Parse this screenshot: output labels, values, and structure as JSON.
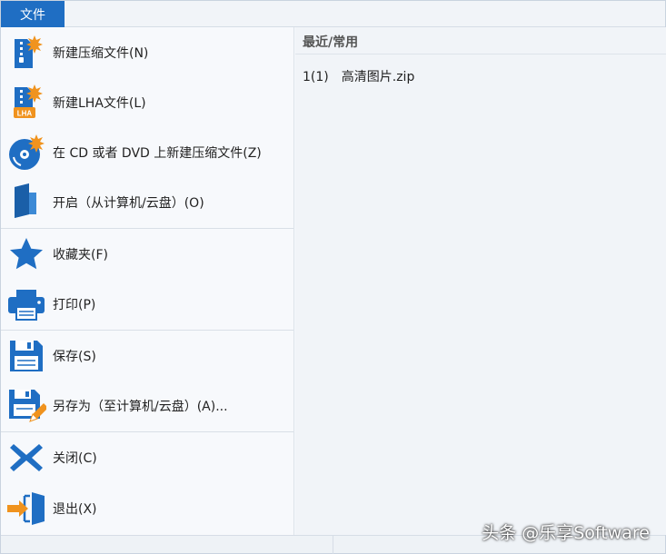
{
  "menubar": {
    "file_tab": "文件"
  },
  "menu_items": [
    {
      "label": "新建压缩文件(N)",
      "icon": "new-zip-icon"
    },
    {
      "label": "新建LHA文件(L)",
      "icon": "new-lha-icon"
    },
    {
      "label": "在 CD 或者 DVD 上新建压缩文件(Z)",
      "icon": "new-disc-archive-icon"
    },
    {
      "label": "开启（从计算机/云盘）(O)",
      "icon": "open-icon"
    },
    {
      "label": "收藏夹(F)",
      "icon": "star-icon"
    },
    {
      "label": "打印(P)",
      "icon": "printer-icon"
    },
    {
      "label": "保存(S)",
      "icon": "save-icon"
    },
    {
      "label": "另存为（至计算机/云盘）(A)...",
      "icon": "save-as-icon"
    },
    {
      "label": "关闭(C)",
      "icon": "close-icon"
    },
    {
      "label": "退出(X)",
      "icon": "exit-icon"
    }
  ],
  "lha_badge": "LHA",
  "recent": {
    "header": "最近/常用",
    "items": [
      {
        "num": "1(1)",
        "name": "高清图片.zip"
      }
    ]
  },
  "watermark": "头条 @乐享Software",
  "colors": {
    "accent": "#1f6ec3",
    "orange": "#f0931e"
  }
}
